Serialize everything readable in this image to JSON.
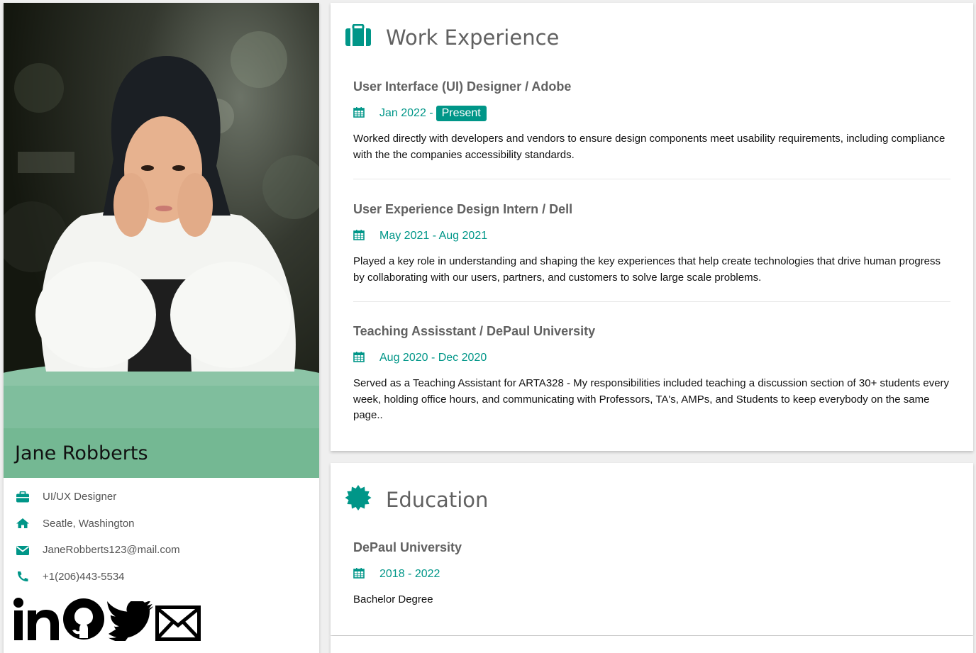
{
  "profile": {
    "name": "Jane Robberts",
    "accent": "#009688",
    "contacts": [
      {
        "icon": "briefcase-icon",
        "text": "UI/UX Designer"
      },
      {
        "icon": "home-icon",
        "text": "Seatle, Washington"
      },
      {
        "icon": "envelope-icon",
        "text": "JaneRobberts123@mail.com"
      },
      {
        "icon": "phone-icon",
        "text": "+1(206)443-5534"
      }
    ],
    "social": [
      "linkedin-icon",
      "github-icon",
      "twitter-icon",
      "mail-icon"
    ]
  },
  "work": {
    "title": "Work Experience",
    "entries": [
      {
        "title": "User Interface (UI) Designer / Adobe",
        "date": "Jan 2022 -",
        "badge": "Present",
        "description": "Worked directly with developers and vendors to ensure design components meet usability requirements, including compliance with the the companies accessibility standards."
      },
      {
        "title": "User Experience Design Intern / Dell",
        "date": "May 2021 - Aug 2021",
        "description": "Played a key role in understanding and shaping the key experiences that help create technologies that drive human progress by collaborating with our users, partners, and customers to solve large scale problems."
      },
      {
        "title": "Teaching Assisstant / DePaul University",
        "date": "Aug 2020 - Dec 2020",
        "description": "Served as a Teaching Assistant for ARTA328 - My responsibilities included teaching a discussion section of 30+ students every week, holding office hours, and communicating with Professors, TA's, AMPs, and Students to keep everybody on the same page.."
      }
    ]
  },
  "education": {
    "title": "Education",
    "entries": [
      {
        "title": "DePaul University",
        "date": "2018 - 2022",
        "description": "Bachelor Degree"
      }
    ]
  }
}
